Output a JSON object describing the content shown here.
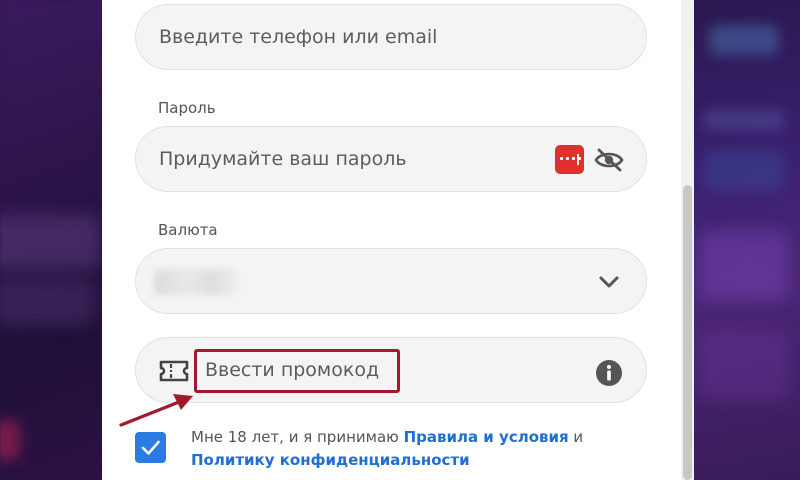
{
  "form": {
    "login_placeholder": "Введите телефон или email",
    "password": {
      "label": "Пароль",
      "placeholder": "Придумайте ваш пароль",
      "manager_icon": "password-manager-icon",
      "toggle_icon": "eye-slash-icon"
    },
    "currency": {
      "label": "Валюта",
      "value": "",
      "dropdown_icon": "chevron-down-icon"
    },
    "promo": {
      "text": "Ввести промокод",
      "icon": "ticket-icon",
      "info_icon": "info-icon"
    },
    "consent": {
      "checked": true,
      "prefix": "Мне 18 лет, и я принимаю",
      "rules_link": "Правила и условия",
      "conjunction": "и",
      "privacy_link": "Политику конфиденциальности"
    }
  },
  "colors": {
    "accent": "#2a7be4",
    "link": "#1f6fd1",
    "highlight": "#a01a2c",
    "password_manager": "#e0302e"
  }
}
